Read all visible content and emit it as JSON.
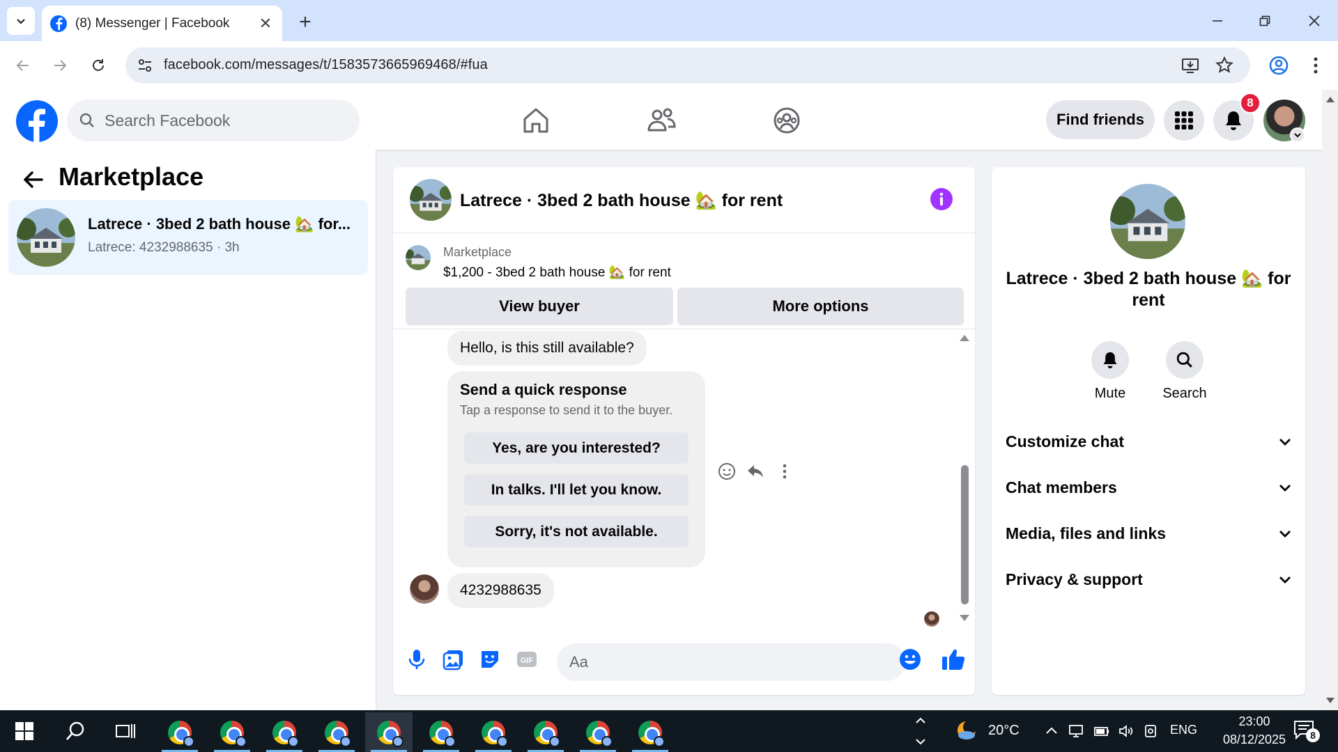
{
  "browser": {
    "tab_title": "(8) Messenger | Facebook",
    "url": "facebook.com/messages/t/1583573665969468/#fua"
  },
  "header": {
    "search_placeholder": "Search Facebook",
    "find_friends_label": "Find friends",
    "notification_count": "8"
  },
  "left_panel": {
    "title": "Marketplace",
    "conversations": [
      {
        "name": "Latrece · 3bed 2 bath house 🏡 for...",
        "preview": "Latrece: 4232988635 · 3h"
      }
    ]
  },
  "chat": {
    "title": "Latrece · 3bed 2 bath house 🏡 for rent",
    "listing": {
      "source": "Marketplace",
      "title": "$1,200 - 3bed 2 bath house 🏡 for rent",
      "view_buyer_label": "View buyer",
      "more_options_label": "More options"
    },
    "messages": {
      "first": "Hello, is this still available?",
      "quick_response_title": "Send a quick response",
      "quick_response_subtitle": "Tap a response to send it to the buyer.",
      "quick_responses": [
        "Yes, are you interested?",
        "In talks. I'll let you know.",
        "Sorry, it's not available."
      ],
      "last": "4232988635"
    },
    "composer_placeholder": "Aa"
  },
  "right_panel": {
    "name": "Latrece · 3bed 2 bath house 🏡 for rent",
    "mute_label": "Mute",
    "search_label": "Search",
    "sections": [
      "Customize chat",
      "Chat members",
      "Media, files and links",
      "Privacy & support"
    ]
  },
  "taskbar": {
    "weather": "20°C",
    "language": "ENG",
    "time": "23:00",
    "date": "08/12/2025",
    "notification_count": "8"
  },
  "colors": {
    "facebook_blue": "#0866ff",
    "messenger_purple": "#a033ff",
    "notification_red": "#e41e3f",
    "selected_conversation": "#ebf5ff"
  }
}
